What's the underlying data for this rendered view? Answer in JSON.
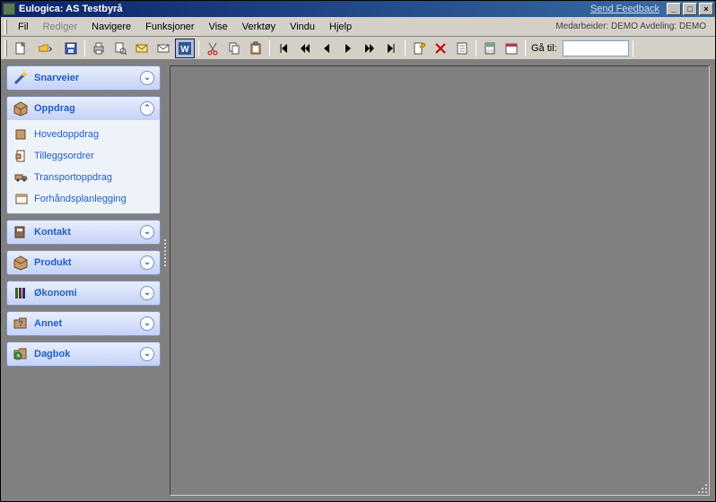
{
  "title": "Eulogica: AS Testbyrå",
  "send_feedback": "Send Feedback",
  "menu": {
    "fil": "Fil",
    "rediger": "Rediger",
    "navigere": "Navigere",
    "funksjoner": "Funksjoner",
    "vise": "Vise",
    "verktoy": "Verktøy",
    "vindu": "Vindu",
    "hjelp": "Hjelp"
  },
  "status": "Medarbeider: DEMO  Avdeling: DEMO",
  "goto_label": "Gå til:",
  "goto_value": "",
  "groups": {
    "snarveier": {
      "label": "Snarveier"
    },
    "oppdrag": {
      "label": "Oppdrag",
      "items": {
        "hovedoppdrag": "Hovedoppdrag",
        "tilleggsordrer": "Tilleggsordrer",
        "transportoppdrag": "Transportoppdrag",
        "forhandsplanlegging": "Forhåndsplanlegging"
      }
    },
    "kontakt": {
      "label": "Kontakt"
    },
    "produkt": {
      "label": "Produkt"
    },
    "okonomi": {
      "label": "Økonomi"
    },
    "annet": {
      "label": "Annet"
    },
    "dagbok": {
      "label": "Dagbok"
    }
  }
}
